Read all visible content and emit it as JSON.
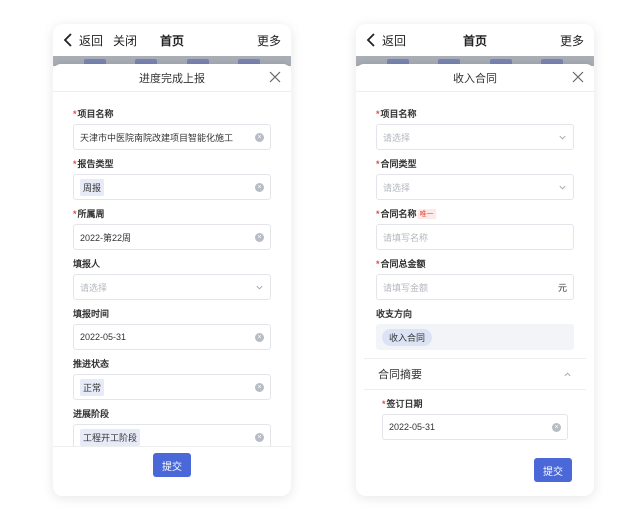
{
  "left": {
    "nav": {
      "back": "返回",
      "close": "关闭",
      "title": "首页",
      "more": "更多"
    },
    "sheet_title": "进度完成上报",
    "fields": [
      {
        "label": "项目名称",
        "required": true,
        "value": "天津市中医院南院改建项目智能化施工",
        "kind": "text-clear"
      },
      {
        "label": "报告类型",
        "required": true,
        "value": "周报",
        "kind": "tag-clear"
      },
      {
        "label": "所属周",
        "required": true,
        "value": "2022-第22周",
        "kind": "text-clear"
      },
      {
        "label": "填报人",
        "required": false,
        "placeholder": "请选择",
        "kind": "select"
      },
      {
        "label": "填报时间",
        "required": false,
        "value": "2022-05-31",
        "kind": "text-clear"
      },
      {
        "label": "推进状态",
        "required": false,
        "value": "正常",
        "kind": "tag-clear"
      },
      {
        "label": "进展阶段",
        "required": false,
        "value": "工程开工阶段",
        "kind": "tag-clear"
      }
    ],
    "submit": "提交"
  },
  "right": {
    "nav": {
      "back": "返回",
      "title": "首页",
      "more": "更多"
    },
    "sheet_title": "收入合同",
    "fields": [
      {
        "label": "项目名称",
        "required": true,
        "placeholder": "请选择",
        "kind": "select"
      },
      {
        "label": "合同类型",
        "required": true,
        "placeholder": "请选择",
        "kind": "select"
      },
      {
        "label": "合同名称",
        "required": true,
        "tip": "唯一",
        "placeholder": "请填写名称",
        "kind": "input"
      },
      {
        "label": "合同总金额",
        "required": true,
        "placeholder": "请填写金额",
        "unit": "元",
        "kind": "input-unit"
      },
      {
        "label": "收支方向",
        "required": false,
        "value": "收入合同",
        "kind": "pill"
      }
    ],
    "section": "合同摘要",
    "section_fields": [
      {
        "label": "签订日期",
        "required": true,
        "value": "2022-05-31",
        "kind": "text-clear"
      }
    ],
    "submit": "提交"
  },
  "colors": {
    "primary": "#4a68d8",
    "required": "#e54d42",
    "tag_bg": "#e7ebf7"
  },
  "icons": {
    "back": "chevron-left-icon",
    "close": "close-icon",
    "clear": "clear-icon",
    "dropdown": "chevron-down-icon",
    "collapse": "chevron-up-icon"
  }
}
